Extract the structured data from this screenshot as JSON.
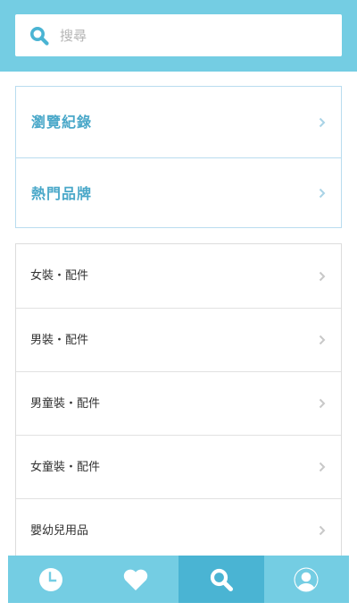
{
  "search": {
    "placeholder": "搜尋",
    "icon": "search-icon"
  },
  "quick_links": [
    {
      "label": "瀏覽紀錄"
    },
    {
      "label": "熱門品牌"
    }
  ],
  "categories": [
    {
      "label": "女裝・配件"
    },
    {
      "label": "男裝・配件"
    },
    {
      "label": "男童裝・配件"
    },
    {
      "label": "女童裝・配件"
    },
    {
      "label": "嬰幼兒用品"
    }
  ],
  "tabbar": {
    "active": "search",
    "tabs": [
      {
        "icon": "clock-icon"
      },
      {
        "icon": "heart-icon"
      },
      {
        "icon": "search-icon"
      },
      {
        "icon": "user-icon"
      }
    ]
  },
  "colors": {
    "header": "#74cde3",
    "accent": "#4aa8c9",
    "tab_active": "#4ab4d3",
    "divider": "#e1e1e1"
  }
}
